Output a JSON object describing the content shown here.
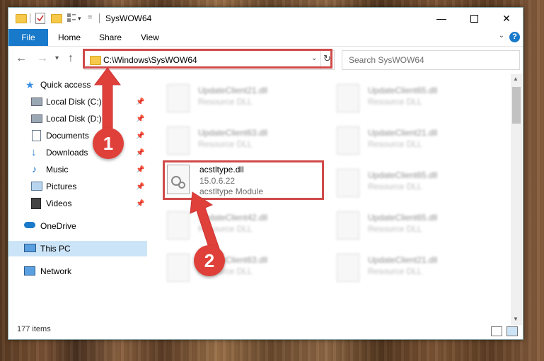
{
  "window": {
    "title": "SysWOW64"
  },
  "ribbon": {
    "tabs": [
      "File",
      "Home",
      "Share",
      "View"
    ],
    "help": "?"
  },
  "address": {
    "path": "C:\\Windows\\SysWOW64"
  },
  "search": {
    "placeholder": "Search SysWOW64"
  },
  "sidebar": {
    "items": [
      {
        "label": "Quick access",
        "icon": "star-icon"
      },
      {
        "label": "Local Disk (C:)",
        "icon": "drive-icon",
        "pinned": true
      },
      {
        "label": "Local Disk (D:)",
        "icon": "drive-icon",
        "pinned": true
      },
      {
        "label": "Documents",
        "icon": "documents-icon",
        "pinned": true
      },
      {
        "label": "Downloads",
        "icon": "downloads-icon",
        "pinned": true
      },
      {
        "label": "Music",
        "icon": "music-icon",
        "pinned": true
      },
      {
        "label": "Pictures",
        "icon": "pictures-icon",
        "pinned": true
      },
      {
        "label": "Videos",
        "icon": "videos-icon",
        "pinned": true
      },
      {
        "label": "OneDrive",
        "icon": "cloud-icon"
      },
      {
        "label": "This PC",
        "icon": "computer-icon",
        "selected": true
      },
      {
        "label": "Network",
        "icon": "network-icon"
      }
    ]
  },
  "files": {
    "background": [
      {
        "name": "UpdateClient21.dll",
        "desc": "Resource DLL"
      },
      {
        "name": "UpdateClient65.dll",
        "desc": "Resource DLL"
      },
      {
        "name": "UpdateClient63.dll",
        "desc": "Resource DLL"
      },
      {
        "name": "UpdateClient21.dll",
        "desc": "Resource DLL"
      },
      {
        "name": "UpdateClient65.dll",
        "desc": "Resource DLL"
      },
      {
        "name": "UpdateClient42.dll",
        "desc": "Resource DLL"
      },
      {
        "name": "UpdateClient65.dll",
        "desc": "Resource DLL"
      },
      {
        "name": "UpdateClient63.dll",
        "desc": "Resource DLL"
      },
      {
        "name": "UpdateClient21.dll",
        "desc": "Resource DLL"
      }
    ],
    "target": {
      "name": "acstltype.dll",
      "version": "15.0.6.22",
      "desc": "acstltype Module"
    }
  },
  "status": {
    "count": "177 items"
  },
  "callouts": {
    "one": "1",
    "two": "2"
  },
  "colors": {
    "accent": "#1979ca",
    "highlight": "#d04a4a",
    "callout": "#e0403a"
  }
}
